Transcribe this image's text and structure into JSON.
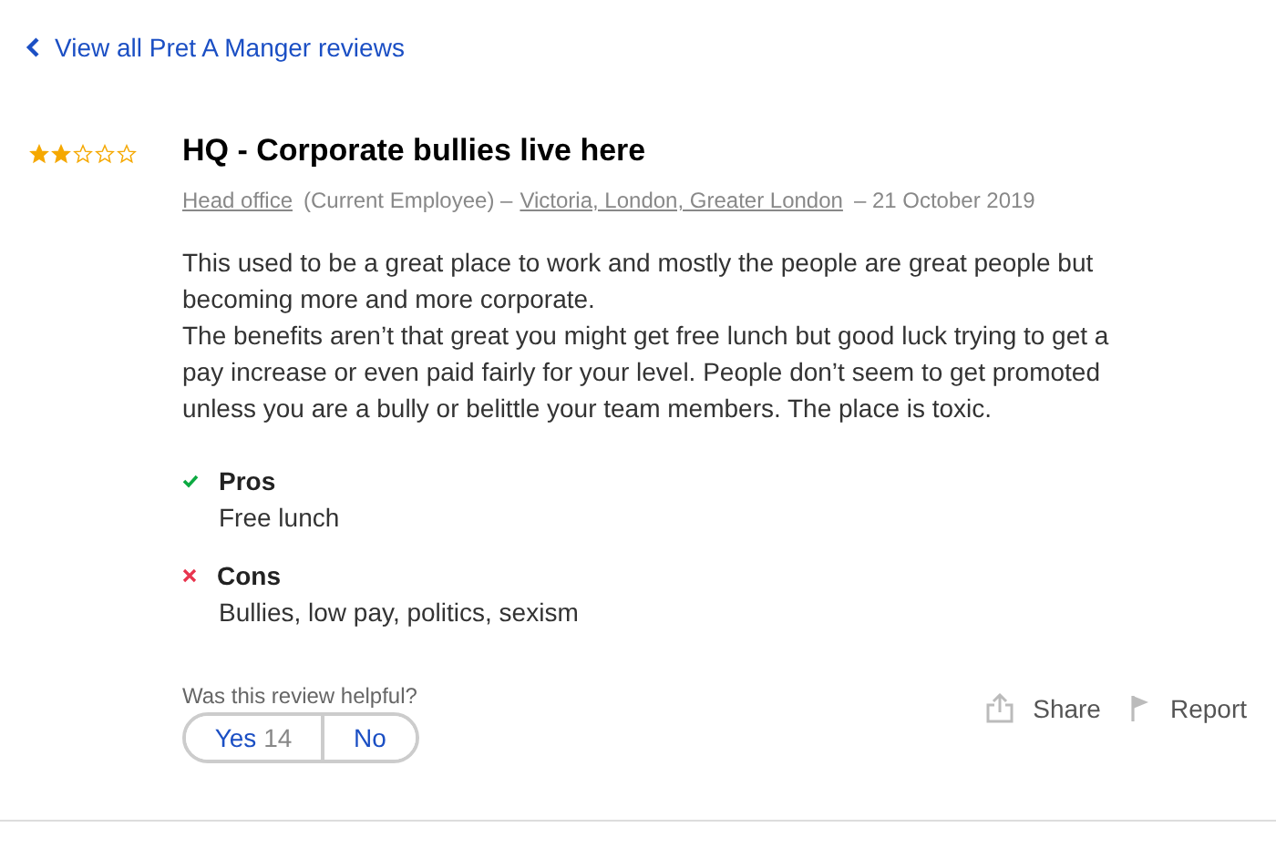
{
  "back_link": {
    "label": "View all Pret A Manger reviews"
  },
  "review": {
    "stars": 2,
    "title": "HQ - Corporate bullies live here",
    "meta": {
      "job": "Head office",
      "status": "(Current Employee) –",
      "location": "Victoria, London, Greater London",
      "date": "– 21 October 2019"
    },
    "body": [
      "This used to be a great place to work and mostly the people are great people but becoming more and more corporate.",
      "The benefits aren’t that great you might get free lunch but good luck trying to get a pay increase or even paid fairly for your level. People don’t seem to get promoted unless you are a bully or belittle your team members. The place is toxic."
    ],
    "sections": [
      {
        "kind": "pros",
        "heading": "Pros",
        "text": "Free lunch"
      },
      {
        "kind": "cons",
        "heading": "Cons",
        "text": "Bullies, low pay, politics, sexism"
      }
    ],
    "helpful": {
      "question": "Was this review helpful?",
      "yes": "Yes",
      "yes_count": "14",
      "no": "No"
    },
    "actions": [
      {
        "kind": "share",
        "label": "Share"
      },
      {
        "kind": "report",
        "label": "Report"
      }
    ]
  }
}
